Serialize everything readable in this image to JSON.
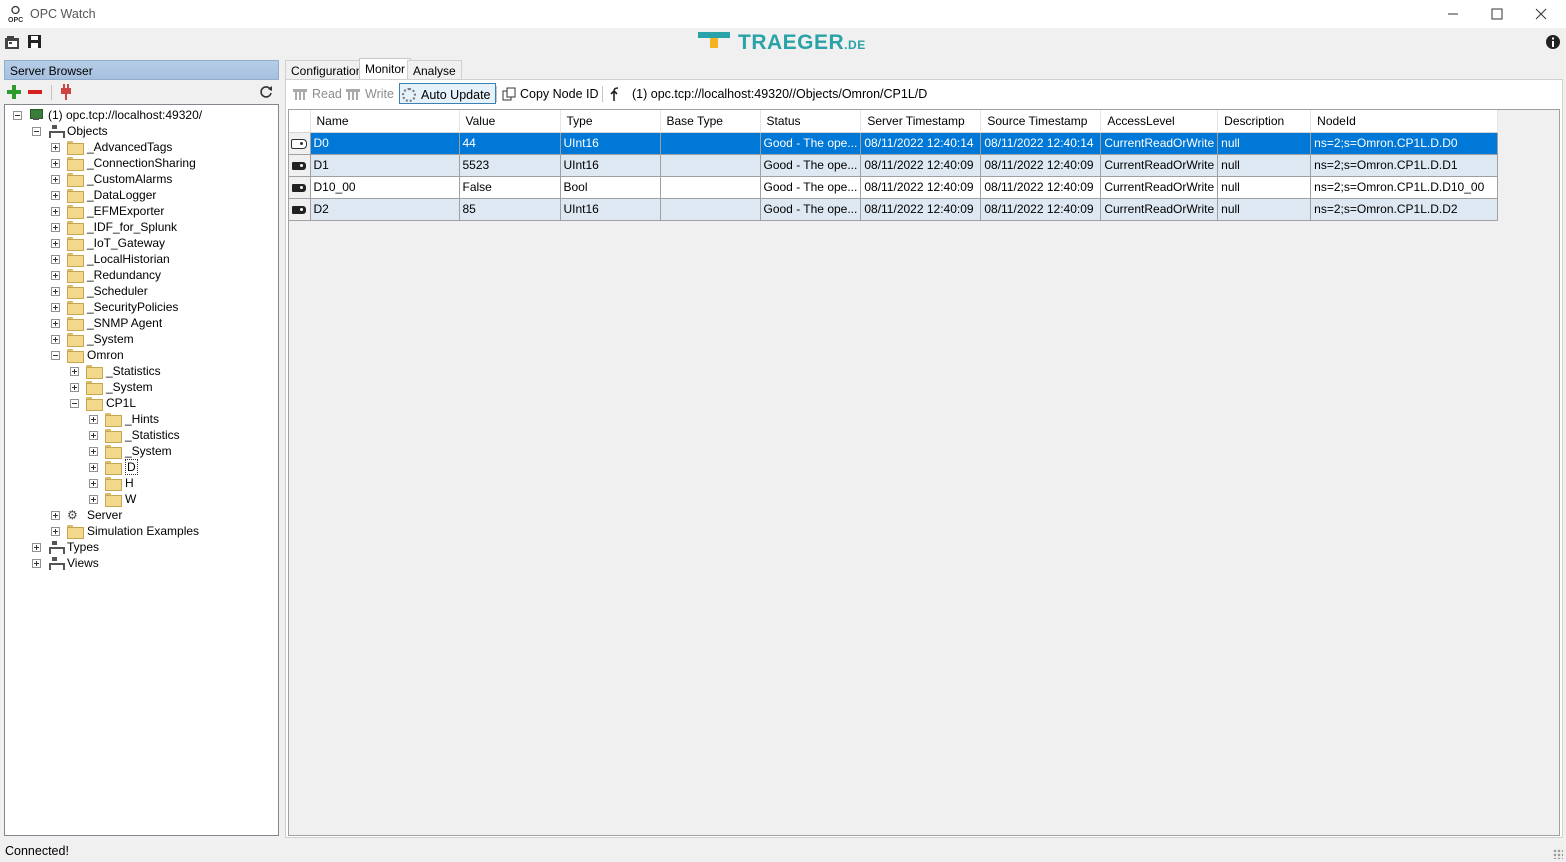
{
  "window": {
    "title": "OPC Watch"
  },
  "logo": {
    "brand": "TRAEGER",
    "suffix": ".DE"
  },
  "server_browser": {
    "title": "Server Browser",
    "tree": [
      {
        "label": "(1) opc.tcp://localhost:49320/",
        "icon": "computer-icon",
        "expander": "minus"
      },
      {
        "label": "Objects",
        "icon": "objects-icon",
        "expander": "minus"
      },
      {
        "label": "_AdvancedTags",
        "icon": "folder-icon",
        "expander": "plus"
      },
      {
        "label": "_ConnectionSharing",
        "icon": "folder-icon",
        "expander": "plus"
      },
      {
        "label": "_CustomAlarms",
        "icon": "folder-icon",
        "expander": "plus"
      },
      {
        "label": "_DataLogger",
        "icon": "folder-icon",
        "expander": "plus"
      },
      {
        "label": "_EFMExporter",
        "icon": "folder-icon",
        "expander": "plus"
      },
      {
        "label": "_IDF_for_Splunk",
        "icon": "folder-icon",
        "expander": "plus"
      },
      {
        "label": "_IoT_Gateway",
        "icon": "folder-icon",
        "expander": "plus"
      },
      {
        "label": "_LocalHistorian",
        "icon": "folder-icon",
        "expander": "plus"
      },
      {
        "label": "_Redundancy",
        "icon": "folder-icon",
        "expander": "plus"
      },
      {
        "label": "_Scheduler",
        "icon": "folder-icon",
        "expander": "plus"
      },
      {
        "label": "_SecurityPolicies",
        "icon": "folder-icon",
        "expander": "plus"
      },
      {
        "label": "_SNMP Agent",
        "icon": "folder-icon",
        "expander": "plus"
      },
      {
        "label": "_System",
        "icon": "folder-icon",
        "expander": "plus"
      },
      {
        "label": "Omron",
        "icon": "folder-icon",
        "expander": "minus"
      },
      {
        "label": "_Statistics",
        "icon": "folder-icon",
        "expander": "plus"
      },
      {
        "label": "_System",
        "icon": "folder-icon",
        "expander": "plus"
      },
      {
        "label": "CP1L",
        "icon": "folder-icon",
        "expander": "minus"
      },
      {
        "label": "_Hints",
        "icon": "folder-icon",
        "expander": "plus"
      },
      {
        "label": "_Statistics",
        "icon": "folder-icon",
        "expander": "plus"
      },
      {
        "label": "_System",
        "icon": "folder-icon",
        "expander": "plus"
      },
      {
        "label": "D",
        "icon": "folder-icon",
        "expander": "plus",
        "selected": true
      },
      {
        "label": "H",
        "icon": "folder-icon",
        "expander": "plus"
      },
      {
        "label": "W",
        "icon": "folder-icon",
        "expander": "plus"
      },
      {
        "label": "Server",
        "icon": "server-icon",
        "expander": "plus"
      },
      {
        "label": "Simulation Examples",
        "icon": "folder-icon",
        "expander": "plus"
      },
      {
        "label": "Types",
        "icon": "objects-icon",
        "expander": "plus"
      },
      {
        "label": "Views",
        "icon": "objects-icon",
        "expander": "plus"
      }
    ]
  },
  "tabs": [
    {
      "label": "Configuration",
      "active": false
    },
    {
      "label": "Monitor",
      "active": true
    },
    {
      "label": "Analyse",
      "active": false
    }
  ],
  "monitor_toolbar": {
    "read": "Read",
    "write": "Write",
    "auto_update": "Auto Update",
    "copy_node_id": "Copy Node ID",
    "path": "(1) opc.tcp://localhost:49320//Objects/Omron/CP1L/D"
  },
  "grid": {
    "columns": [
      "Name",
      "Value",
      "Type",
      "Base Type",
      "Status",
      "Server Timestamp",
      "Source Timestamp",
      "AccessLevel",
      "Description",
      "NodeId"
    ],
    "rows": [
      {
        "cells": [
          "D0",
          "44",
          "UInt16",
          "",
          "Good  -  The ope...",
          "08/11/2022 12:40:14",
          "08/11/2022 12:40:14",
          "CurrentReadOrWrite",
          "null",
          "ns=2;s=Omron.CP1L.D.D0"
        ],
        "selected": true
      },
      {
        "cells": [
          "D1",
          "5523",
          "UInt16",
          "",
          "Good  -  The ope...",
          "08/11/2022 12:40:09",
          "08/11/2022 12:40:09",
          "CurrentReadOrWrite",
          "null",
          "ns=2;s=Omron.CP1L.D.D1"
        ],
        "selected": false
      },
      {
        "cells": [
          "D10_00",
          "False",
          "Bool",
          "",
          "Good  -  The ope...",
          "08/11/2022 12:40:09",
          "08/11/2022 12:40:09",
          "CurrentReadOrWrite",
          "null",
          "ns=2;s=Omron.CP1L.D.D10_00"
        ],
        "selected": false
      },
      {
        "cells": [
          "D2",
          "85",
          "UInt16",
          "",
          "Good  -  The ope...",
          "08/11/2022 12:40:09",
          "08/11/2022 12:40:09",
          "CurrentReadOrWrite",
          "null",
          "ns=2;s=Omron.CP1L.D.D2"
        ],
        "selected": false
      }
    ]
  },
  "status": {
    "text": "Connected!"
  },
  "colors": {
    "accent": "#0078d7",
    "brand": "#2aa3a8",
    "alt_row": "#dde8f3"
  }
}
